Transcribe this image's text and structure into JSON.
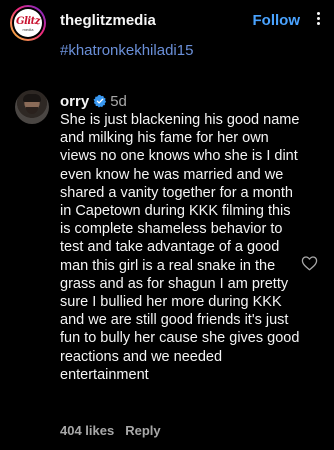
{
  "header": {
    "account_name": "theglitzmedia",
    "follow_label": "Follow",
    "logo_text": "Glitz",
    "logo_subtext": "media"
  },
  "caption_tail": {
    "hashtag": "#khatronkekhiladi15"
  },
  "comment": {
    "username": "orry",
    "verified": true,
    "time_ago": "5d",
    "text": "She is just blackening his good name and milking his fame for her own views no one knows who she is I dint even know he was married and we shared a vanity together for a month in Capetown during KKK filming this is complete shameless behavior to test and take advantage of a good man this girl is a real snake in the grass and as for shagun I am pretty sure I bullied her more during KKK and we are still good friends it's just fun to bully her cause she gives good reactions and we needed entertainment",
    "likes": "404 likes",
    "reply_label": "Reply"
  },
  "icons": {
    "more": "more-icon",
    "verified": "verified-badge-icon",
    "like": "heart-icon"
  },
  "colors": {
    "background": "#000000",
    "text": "#f5f5f5",
    "muted": "#a8a8a8",
    "follow": "#4aa3ff",
    "hashtag": "#6a8fd8",
    "verified": "#3897f0"
  }
}
